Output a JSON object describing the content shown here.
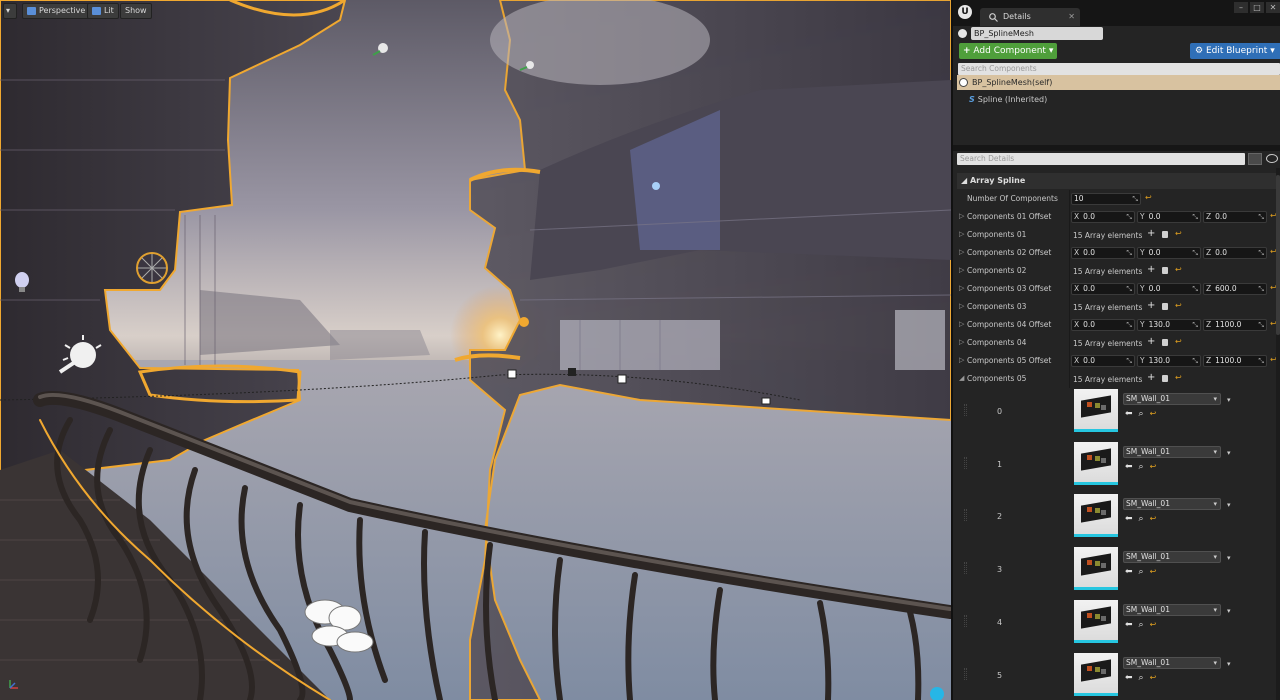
{
  "viewport": {
    "toolbar": {
      "perspective": "Perspective",
      "lit": "Lit",
      "show": "Show"
    }
  },
  "details": {
    "engine_logo": "U",
    "tab_title": "Details",
    "object_name": "BP_SplineMesh",
    "add_component": "Add Component",
    "edit_blueprint": "Edit Blueprint",
    "search_components_placeholder": "Search Components",
    "components": [
      {
        "label": "BP_SplineMesh(self)"
      },
      {
        "label": "Spline (Inherited)"
      }
    ],
    "search_details_placeholder": "Search Details",
    "category": "Array Spline",
    "number_of_components": {
      "label": "Number Of Components",
      "value": "10"
    },
    "array_elements_text": "15 Array elements",
    "offsets": [
      {
        "label": "Components 01 Offset",
        "x": "0.0",
        "y": "0.0",
        "z": "0.0"
      },
      {
        "label": "Components 02 Offset",
        "x": "0.0",
        "y": "0.0",
        "z": "0.0"
      },
      {
        "label": "Components 03 Offset",
        "x": "0.0",
        "y": "0.0",
        "z": "600.0"
      },
      {
        "label": "Components 04 Offset",
        "x": "0.0",
        "y": "130.0",
        "z": "1100.0"
      },
      {
        "label": "Components 05 Offset",
        "x": "0.0",
        "y": "130.0",
        "z": "1100.0"
      }
    ],
    "arrays": [
      {
        "label": "Components 01"
      },
      {
        "label": "Components 02"
      },
      {
        "label": "Components 03"
      },
      {
        "label": "Components 04"
      },
      {
        "label": "Components 05"
      }
    ],
    "elements": [
      {
        "index": "0",
        "asset": "SM_Wall_01"
      },
      {
        "index": "1",
        "asset": "SM_Wall_01"
      },
      {
        "index": "2",
        "asset": "SM_Wall_01"
      },
      {
        "index": "3",
        "asset": "SM_Wall_01"
      },
      {
        "index": "4",
        "asset": "SM_Wall_01"
      },
      {
        "index": "5",
        "asset": "SM_Wall_01"
      }
    ]
  }
}
